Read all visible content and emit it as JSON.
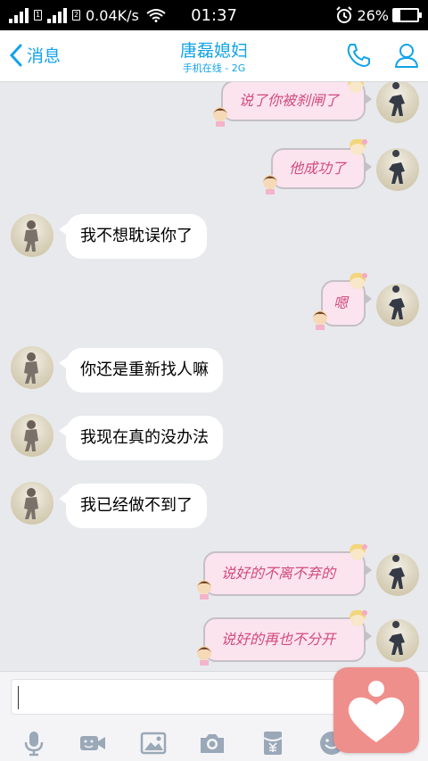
{
  "status_bar": {
    "speed": "0.04K/s",
    "time": "01:37",
    "battery": "26%",
    "battery_level": 0.26
  },
  "header": {
    "back_label": "消息",
    "title": "唐磊媳妇",
    "subtitle": "手机在线 - 2G"
  },
  "messages": [
    {
      "side": "out",
      "text": "说了你被刹闸了"
    },
    {
      "side": "out",
      "text": "他成功了"
    },
    {
      "side": "in",
      "text": "我不想耽误你了"
    },
    {
      "side": "out",
      "text": "嗯"
    },
    {
      "side": "in",
      "text": "你还是重新找人嘛"
    },
    {
      "side": "in",
      "text": "我现在真的没办法"
    },
    {
      "side": "in",
      "text": "我已经做不到了"
    },
    {
      "side": "out",
      "text": "说好的不离不弃的"
    },
    {
      "side": "out",
      "text": "说好的再也不分开"
    }
  ],
  "composer": {
    "value": ""
  },
  "colors": {
    "accent": "#12a3e8",
    "outgoing_bubble": "#fbe4ee",
    "outgoing_text": "#d2497f",
    "fab": "#ef8f8b"
  },
  "icons": [
    "phone-icon",
    "contact-icon",
    "mic-icon",
    "video-icon",
    "image-icon",
    "camera-icon",
    "red-packet-icon",
    "emoji-icon",
    "heart-icon"
  ]
}
